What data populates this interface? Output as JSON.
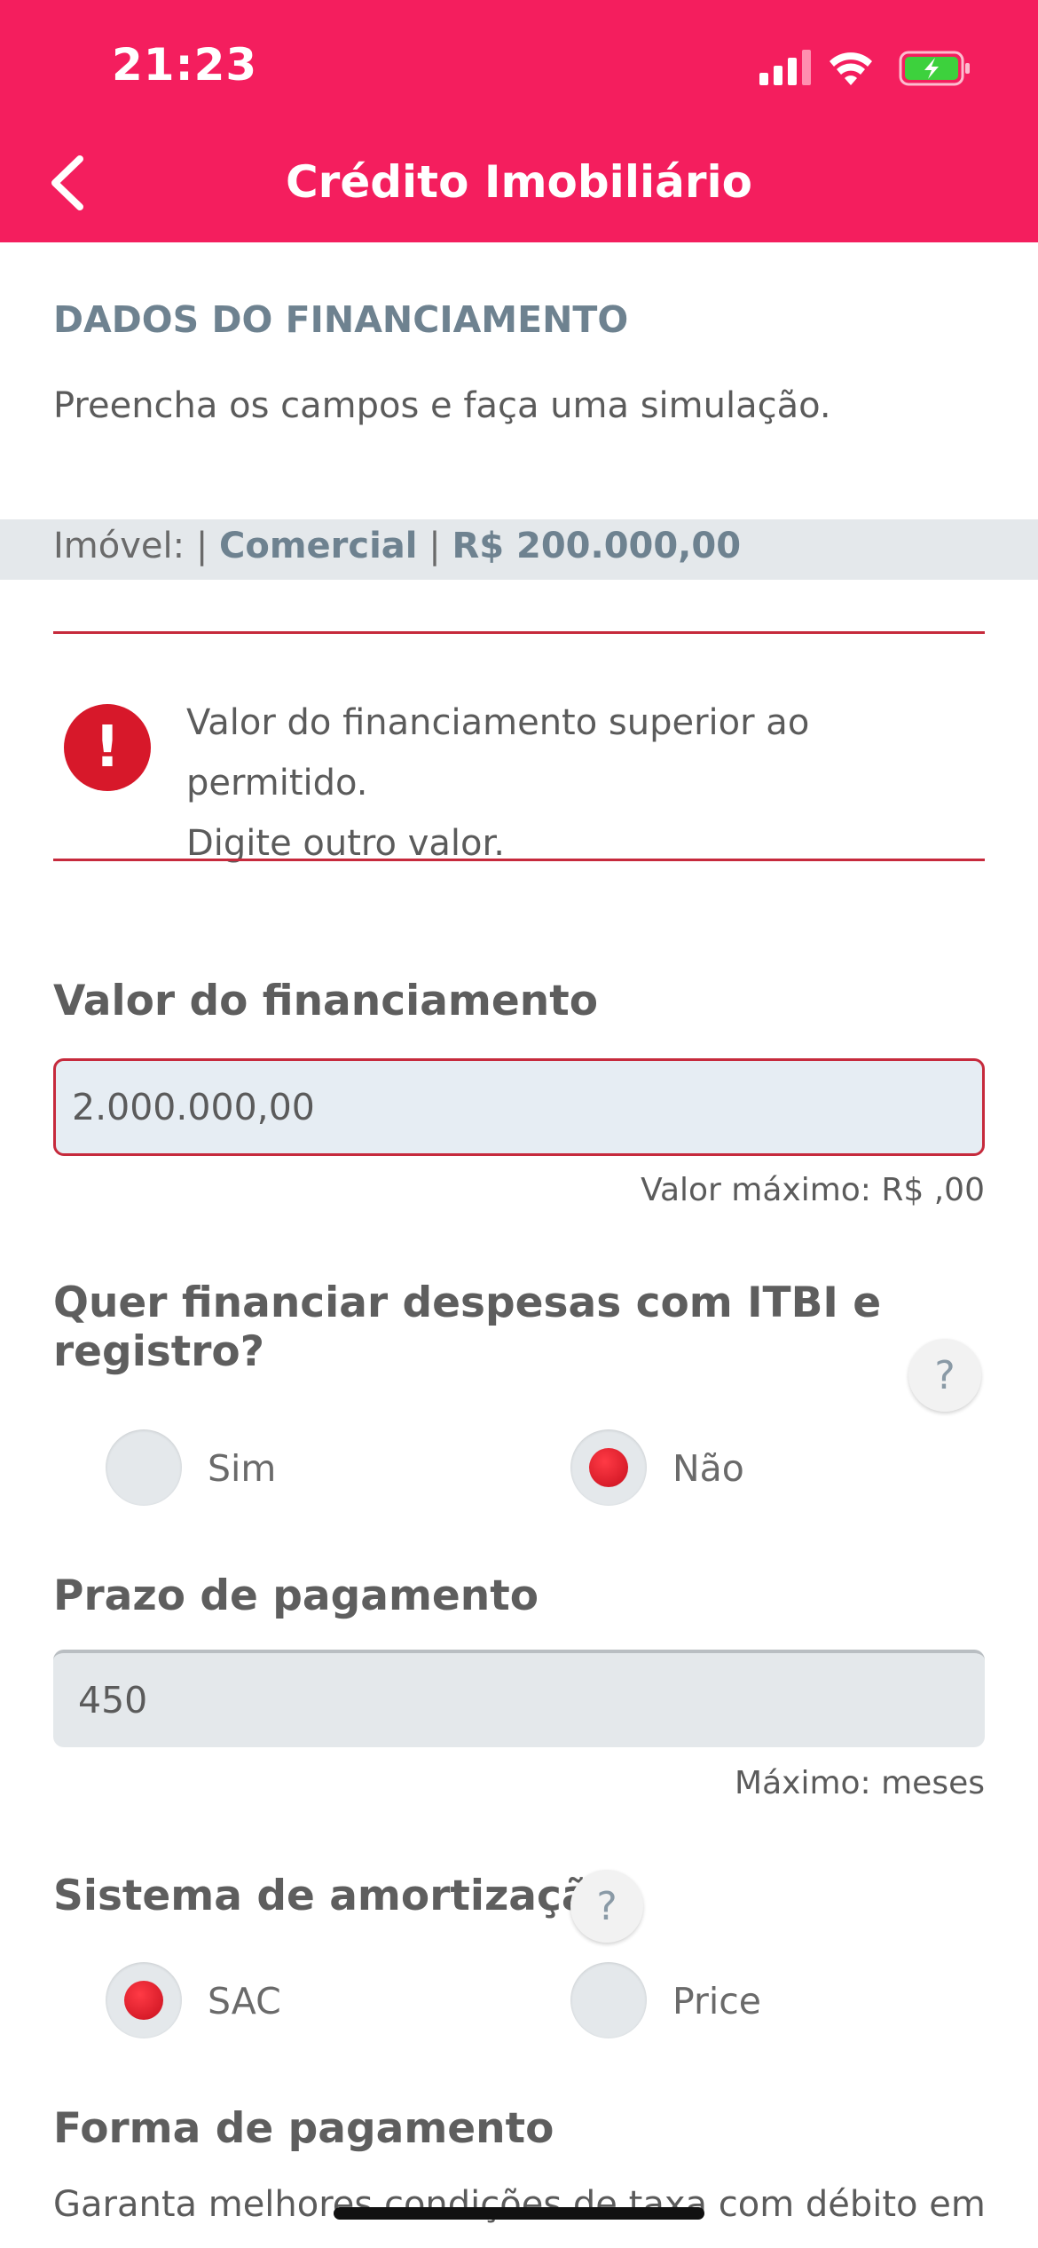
{
  "status_bar": {
    "time": "21:23"
  },
  "header": {
    "title": "Crédito Imobiliário"
  },
  "section": {
    "title": "DADOS DO FINANCIAMENTO",
    "subtitle": "Preencha os campos e faça uma simulação."
  },
  "property": {
    "prefix": "Imóvel: |",
    "type": "Comercial",
    "separator": "|",
    "value": "R$ 200.000,00"
  },
  "alert": {
    "icon": "exclamation-icon",
    "line1": "Valor do financiamento superior ao permitido.",
    "line2": "Digite outro valor."
  },
  "financing": {
    "label": "Valor do financiamento",
    "value": "2.000.000,00",
    "hint": "Valor máximo: R$ ,00"
  },
  "expenses": {
    "label": "Quer financiar despesas com ITBI e registro?",
    "help": "?",
    "options": [
      {
        "label": "Sim",
        "selected": false
      },
      {
        "label": "Não",
        "selected": true
      }
    ]
  },
  "term": {
    "label": "Prazo de pagamento",
    "value": "450",
    "hint": "Máximo: meses"
  },
  "amortization": {
    "label": "Sistema de amortização",
    "help": "?",
    "options": [
      {
        "label": "SAC",
        "selected": true
      },
      {
        "label": "Price",
        "selected": false
      }
    ]
  },
  "payment": {
    "label": "Forma de pagamento",
    "text": "Garanta melhores condições de taxa com débito em"
  },
  "colors": {
    "header": "#f41e5e",
    "error": "#c62a3c",
    "accent_text": "#6e8290"
  }
}
